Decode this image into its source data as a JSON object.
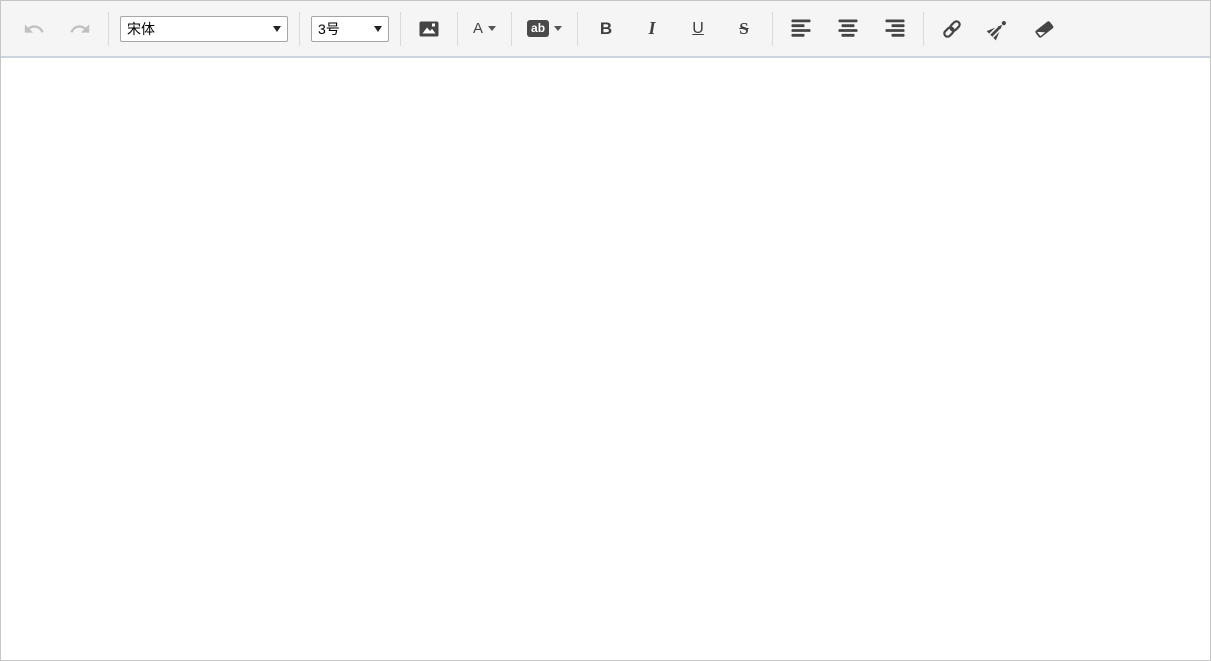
{
  "toolbar": {
    "font_family": {
      "value": "宋体"
    },
    "font_size": {
      "value": "3号"
    },
    "font_color_label": "A",
    "highlight_label": "ab",
    "bold_label": "B",
    "italic_label": "I",
    "underline_label": "U",
    "strikethrough_label": "S",
    "icons": {
      "undo": "curved-arrow-left",
      "redo": "curved-arrow-right",
      "insert_image": "picture",
      "font_color_caret": "triangle-down",
      "highlight_caret": "triangle-down",
      "align_left": "lines-flush-left",
      "align_center": "lines-centered",
      "align_right": "lines-flush-right",
      "link": "chain-link",
      "format_brush": "paint-brush",
      "eraser": "eraser-block"
    }
  },
  "content": {
    "text": ""
  },
  "colors": {
    "toolbar_bg": "#f5f5f5",
    "toolbar_border_bottom": "#ccd3dd",
    "widget_border": "#c6c6c6",
    "icon": "#454545",
    "icon_disabled": "#c0c0c0",
    "separator": "#dadada",
    "select_border": "#a6a6a6",
    "highlight_badge_bg": "#4a4a4a",
    "badge_text": "#ffffff"
  }
}
